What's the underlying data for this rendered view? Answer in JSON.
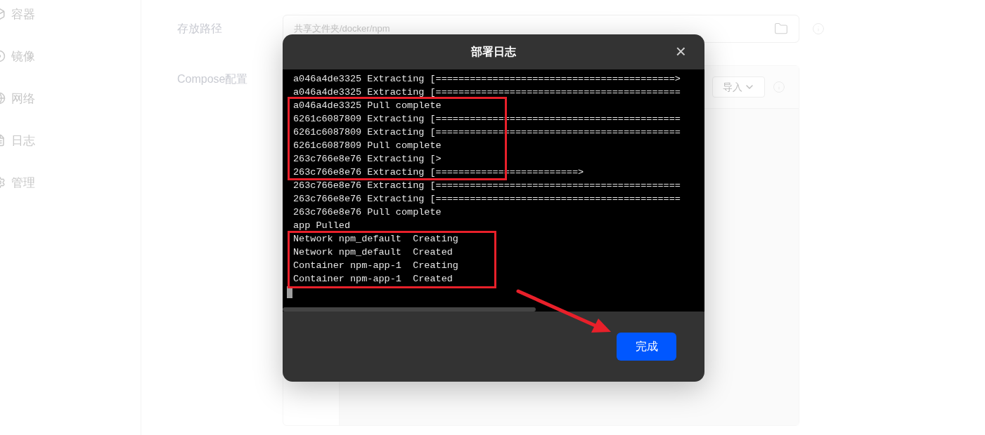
{
  "sidebar": {
    "items": [
      {
        "label": "容器"
      },
      {
        "label": "镜像"
      },
      {
        "label": "网络"
      },
      {
        "label": "日志"
      },
      {
        "label": "管理"
      }
    ]
  },
  "form": {
    "path_label": "存放路径",
    "path_value": "共享文件夹/docker/npm",
    "compose_label": "Compose配置",
    "import_button": "导入"
  },
  "dialog": {
    "title": "部署日志",
    "close": "×",
    "log_lines": [
      "a046a4de3325 Extracting [==========================================>",
      "a046a4de3325 Extracting [===========================================",
      "a046a4de3325 Pull complete",
      "6261c6087809 Extracting [===========================================",
      "6261c6087809 Extracting [===========================================",
      "6261c6087809 Pull complete",
      "263c766e8e76 Extracting [>",
      "263c766e8e76 Extracting [=========================>",
      "263c766e8e76 Extracting [===========================================",
      "263c766e8e76 Extracting [===========================================",
      "263c766e8e76 Pull complete",
      "app Pulled",
      "Network npm_default  Creating",
      "Network npm_default  Created",
      "Container npm-app-1  Creating",
      "Container npm-app-1  Created"
    ],
    "done_button": "完成"
  }
}
